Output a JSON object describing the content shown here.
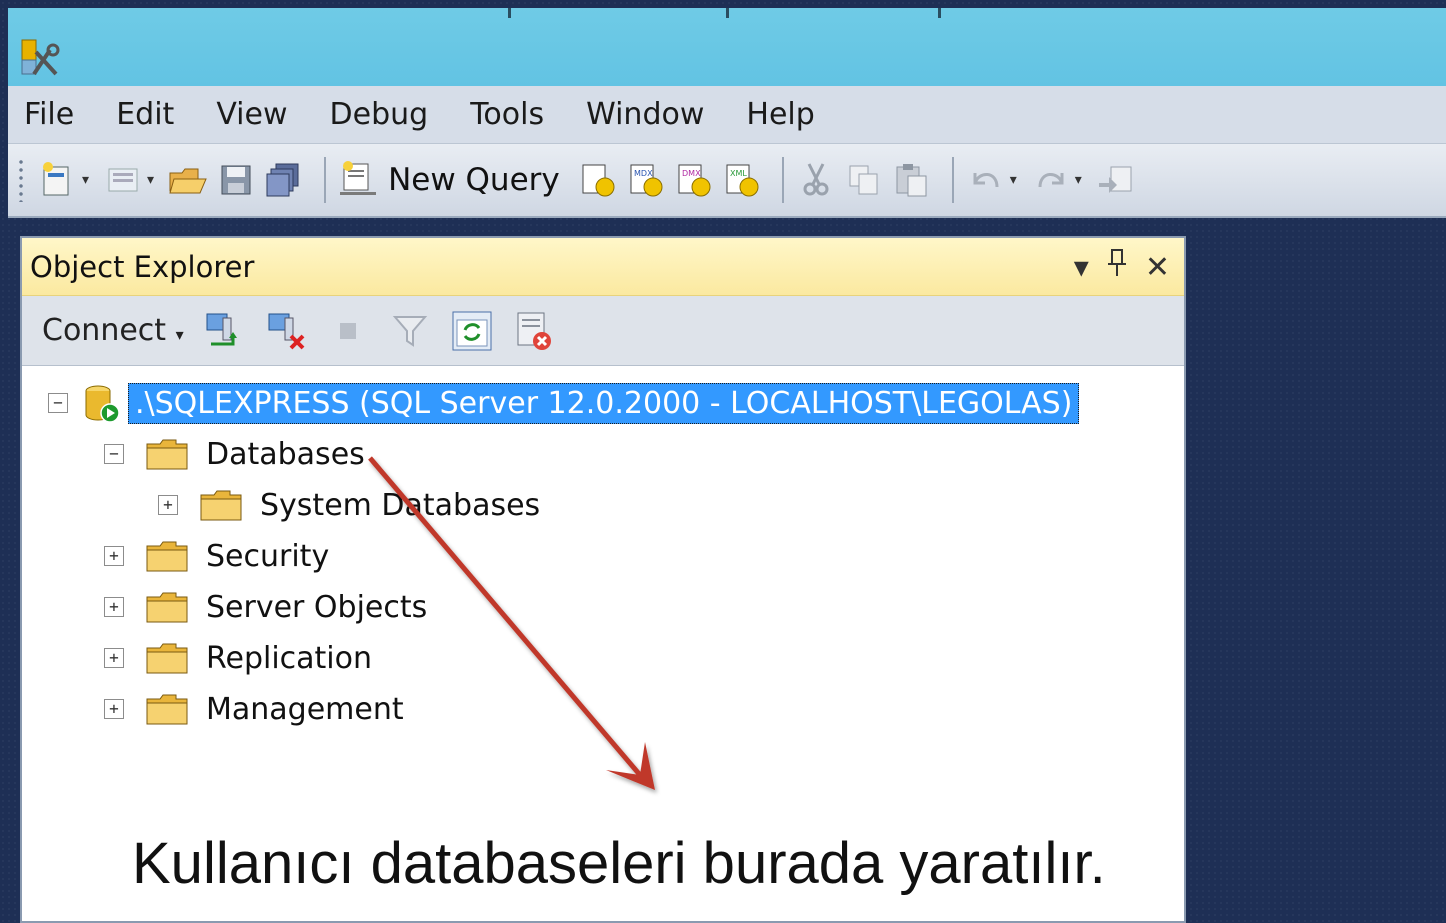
{
  "menu": {
    "items": [
      "File",
      "Edit",
      "View",
      "Debug",
      "Tools",
      "Window",
      "Help"
    ]
  },
  "toolbar": {
    "new_query_label": "New Query",
    "icons": [
      "new-project-icon",
      "add-item-icon",
      "open-file-icon",
      "save-icon",
      "save-all-icon",
      "new-query-icon",
      "database-engine-query-icon",
      "analysis-mdx-query-icon",
      "analysis-dmx-query-icon",
      "analysis-xmla-query-icon",
      "cut-icon",
      "copy-icon",
      "paste-icon",
      "undo-icon",
      "redo-icon",
      "navigate-icon"
    ]
  },
  "object_explorer": {
    "title": "Object Explorer",
    "controls": {
      "dropdown": "▾",
      "pin": "⊥",
      "close": "✕"
    },
    "toolbar": {
      "connect_label": "Connect",
      "icons": [
        "connect-object-explorer-icon",
        "disconnect-icon",
        "stop-icon",
        "filter-icon",
        "refresh-icon",
        "activity-monitor-icon"
      ]
    },
    "tree": {
      "server": ".\\SQLEXPRESS (SQL Server 12.0.2000 - LOCALHOST\\LEGOLAS)",
      "databases": "Databases",
      "system_databases": "System Databases",
      "security": "Security",
      "server_objects": "Server Objects",
      "replication": "Replication",
      "management": "Management"
    }
  },
  "annotation": {
    "caption": "Kullanıcı databaseleri burada yaratılır.",
    "arrow_color": "#c0392b"
  }
}
